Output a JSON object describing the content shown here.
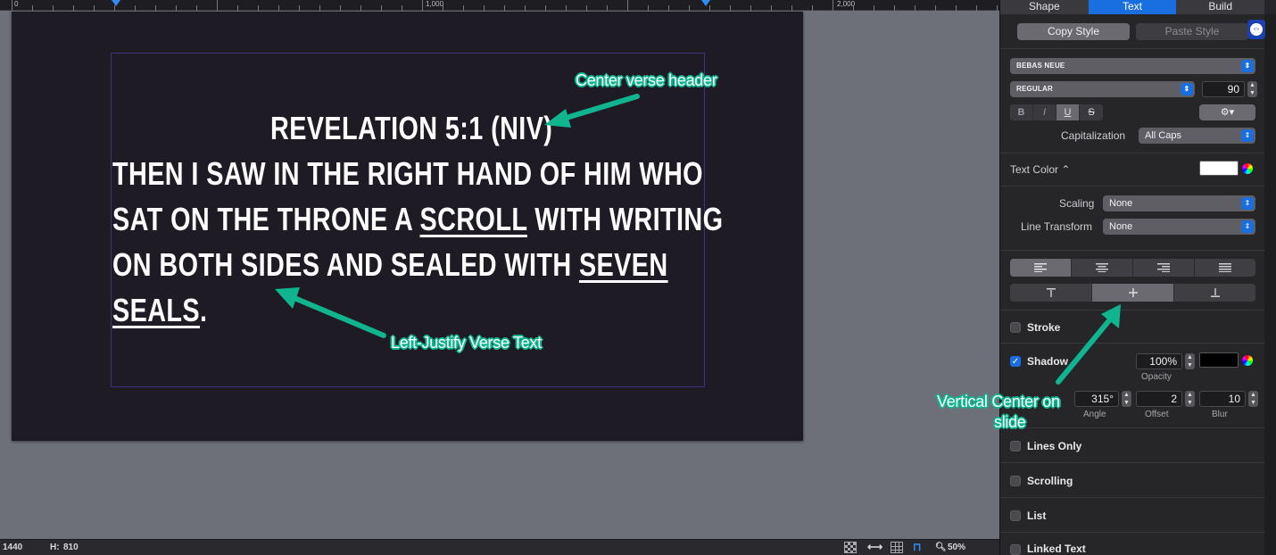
{
  "ruler": {
    "labels": [
      "0",
      "1,000",
      "2,000"
    ]
  },
  "slide": {
    "header": "REVELATION 5:1 (NIV)",
    "lines": [
      [
        {
          "t": "THEN I SAW IN THE RIGHT HAND OF HIM WHO"
        }
      ],
      [
        {
          "t": "SAT ON THE THRONE A "
        },
        {
          "t": "SCROLL",
          "u": true
        },
        {
          "t": " WITH WRITING"
        }
      ],
      [
        {
          "t": "ON BOTH SIDES AND SEALED WITH "
        },
        {
          "t": "SEVEN",
          "u": true
        }
      ],
      [
        {
          "t": "SEALS",
          "u": true
        },
        {
          "t": "."
        }
      ]
    ]
  },
  "annotations": {
    "center_header": "Center verse header",
    "left_justify": "Left-Justify Verse Text",
    "vertical_center_1": "Vertical Center on",
    "vertical_center_2": "slide",
    "color": "#10b58f"
  },
  "status": {
    "width": "1440",
    "height_label": "H:",
    "height": "810",
    "zoom": "50%"
  },
  "inspector": {
    "tabs": [
      "Shape",
      "Text",
      "Build"
    ],
    "active_tab": "Text",
    "copy_style": "Copy Style",
    "paste_style": "Paste Style",
    "font_family": "BEBAS NEUE",
    "font_style": "REGULAR",
    "font_size": "90",
    "format_buttons": [
      "B",
      "I",
      "U",
      "S"
    ],
    "gear": "⚙▾",
    "capitalization_label": "Capitalization",
    "capitalization": "All Caps",
    "text_color_label": "Text Color ⌃",
    "text_color": "#ffffff",
    "scaling_label": "Scaling",
    "scaling": "None",
    "line_transform_label": "Line Transform",
    "line_transform": "None",
    "stroke_label": "Stroke",
    "shadow_label": "Shadow",
    "shadow_opacity": "100%",
    "opacity_label": "Opacity",
    "shadow_color": "#000000",
    "shadow_angle": "315°",
    "angle_label": "Angle",
    "shadow_offset": "2",
    "offset_label": "Offset",
    "shadow_blur": "10",
    "blur_label": "Blur",
    "lines_only_label": "Lines Only",
    "scrolling_label": "Scrolling",
    "list_label": "List",
    "linked_text_label": "Linked Text"
  }
}
